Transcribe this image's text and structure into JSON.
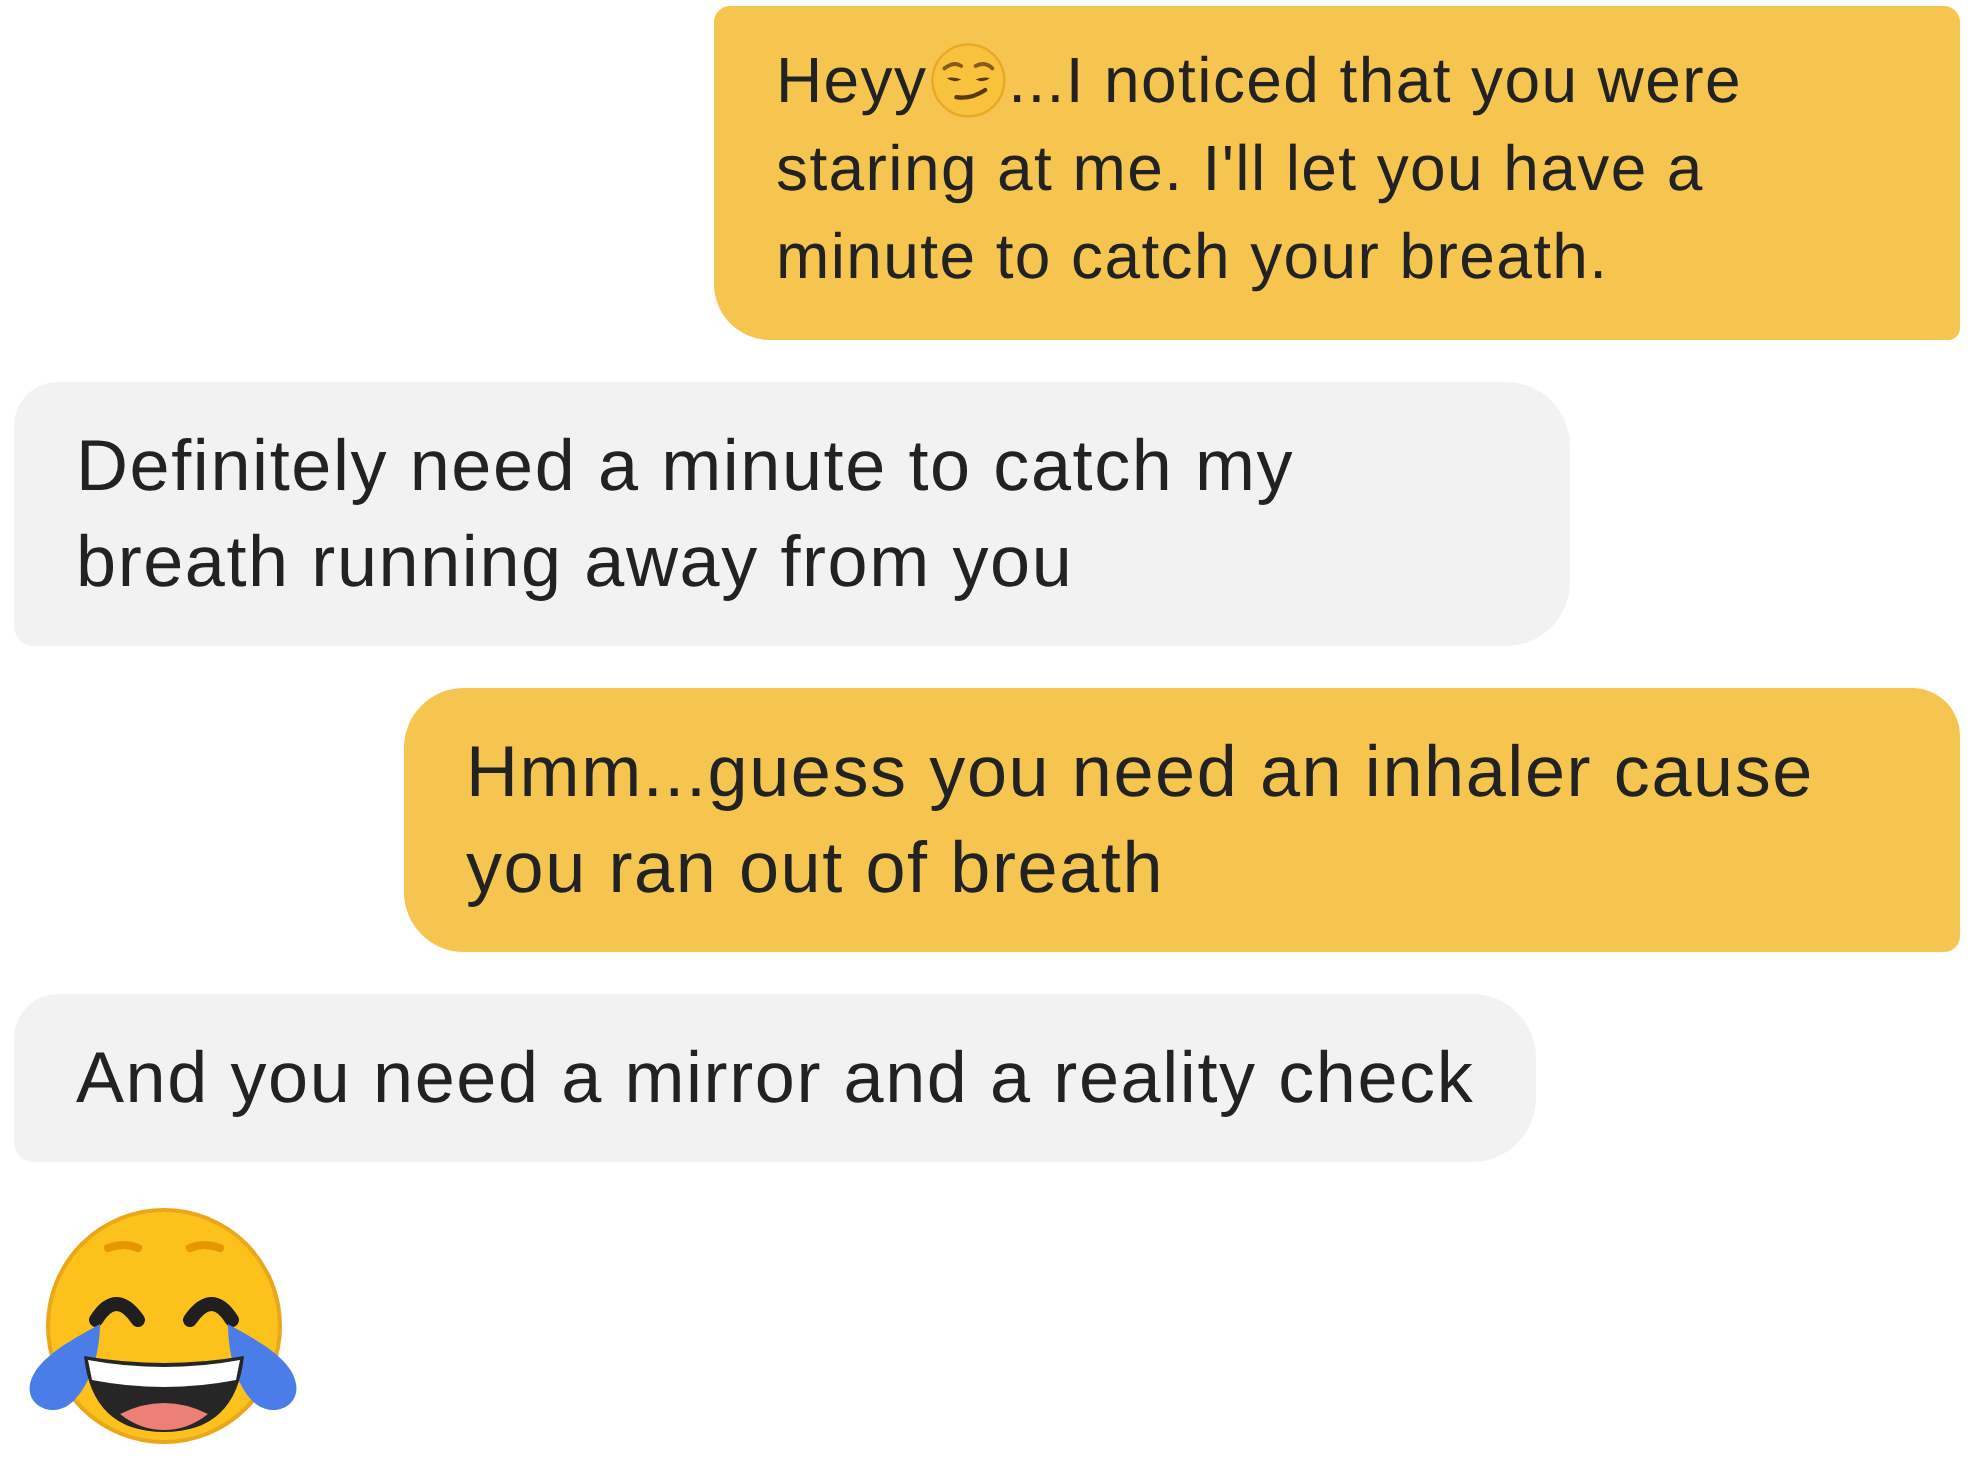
{
  "messages": [
    {
      "kind": "sent",
      "parts": [
        {
          "kind": "text",
          "text": "Heyy"
        },
        {
          "kind": "smirk"
        },
        {
          "kind": "text",
          "text": "...I noticed that you were staring at me. I'll let you have a minute to catch your breath."
        }
      ]
    },
    {
      "kind": "received",
      "parts": [
        {
          "kind": "text",
          "text": "Definitely need a minute to catch my breath running away from you"
        }
      ]
    },
    {
      "kind": "sent",
      "parts": [
        {
          "kind": "text",
          "text": "Hmm...guess you need an inhaler cause you ran out of breath"
        }
      ]
    },
    {
      "kind": "received",
      "parts": [
        {
          "kind": "text",
          "text": "And you need a mirror and a reality check"
        }
      ]
    },
    {
      "kind": "emoji",
      "parts": [
        {
          "kind": "laughing"
        }
      ]
    }
  ]
}
